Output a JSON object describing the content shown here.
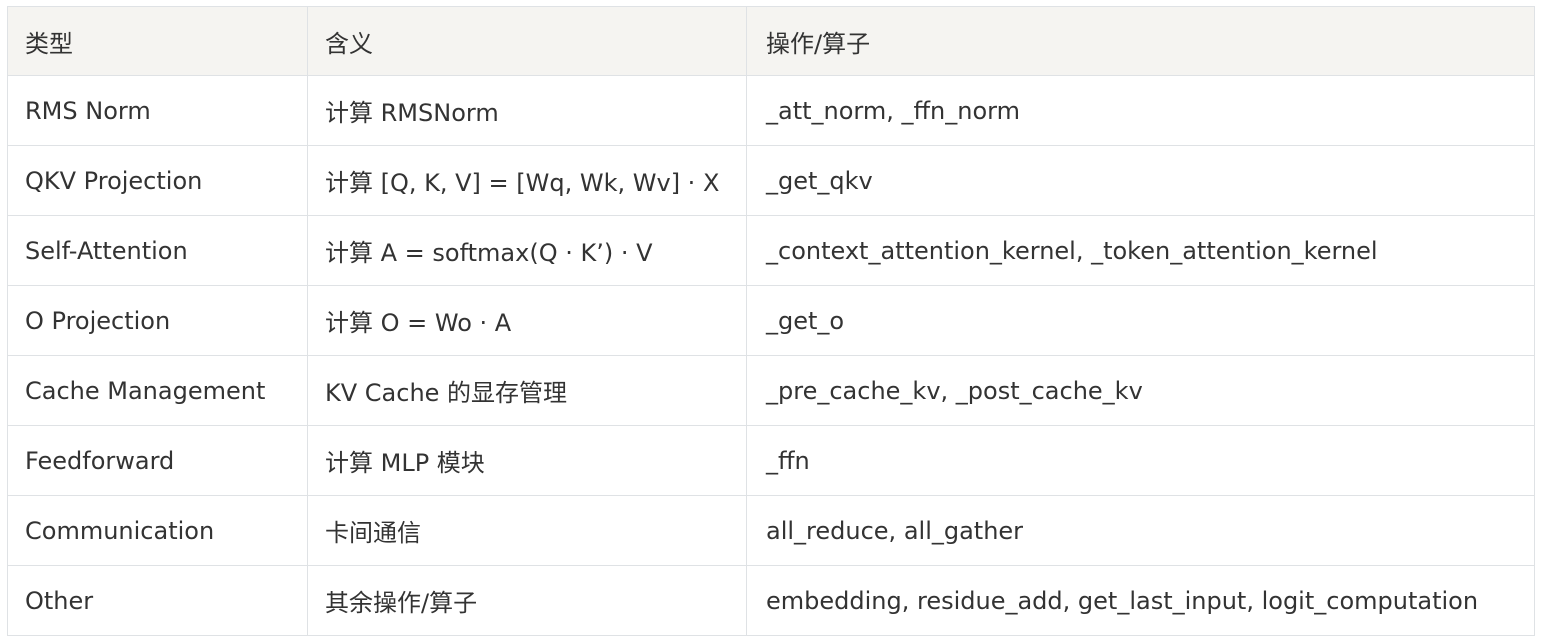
{
  "table": {
    "headers": [
      "类型",
      "含义",
      "操作/算子"
    ],
    "rows": [
      [
        "RMS Norm",
        "计算 RMSNorm",
        "_att_norm, _ffn_norm"
      ],
      [
        "QKV Projection",
        "计算 [Q, K, V] = [Wq, Wk, Wv] · X",
        "_get_qkv"
      ],
      [
        "Self-Attention",
        "计算 A = softmax(Q · K’) · V",
        "_context_attention_kernel, _token_attention_kernel"
      ],
      [
        "O Projection",
        "计算 O = Wo · A",
        "_get_o"
      ],
      [
        "Cache Management",
        "KV Cache 的显存管理",
        "_pre_cache_kv, _post_cache_kv"
      ],
      [
        "Feedforward",
        "计算 MLP 模块",
        "_ffn"
      ],
      [
        "Communication",
        "卡间通信",
        "all_reduce, all_gather"
      ],
      [
        "Other",
        "其余操作/算子",
        "embedding, residue_add, get_last_input, logit_computation"
      ]
    ]
  }
}
